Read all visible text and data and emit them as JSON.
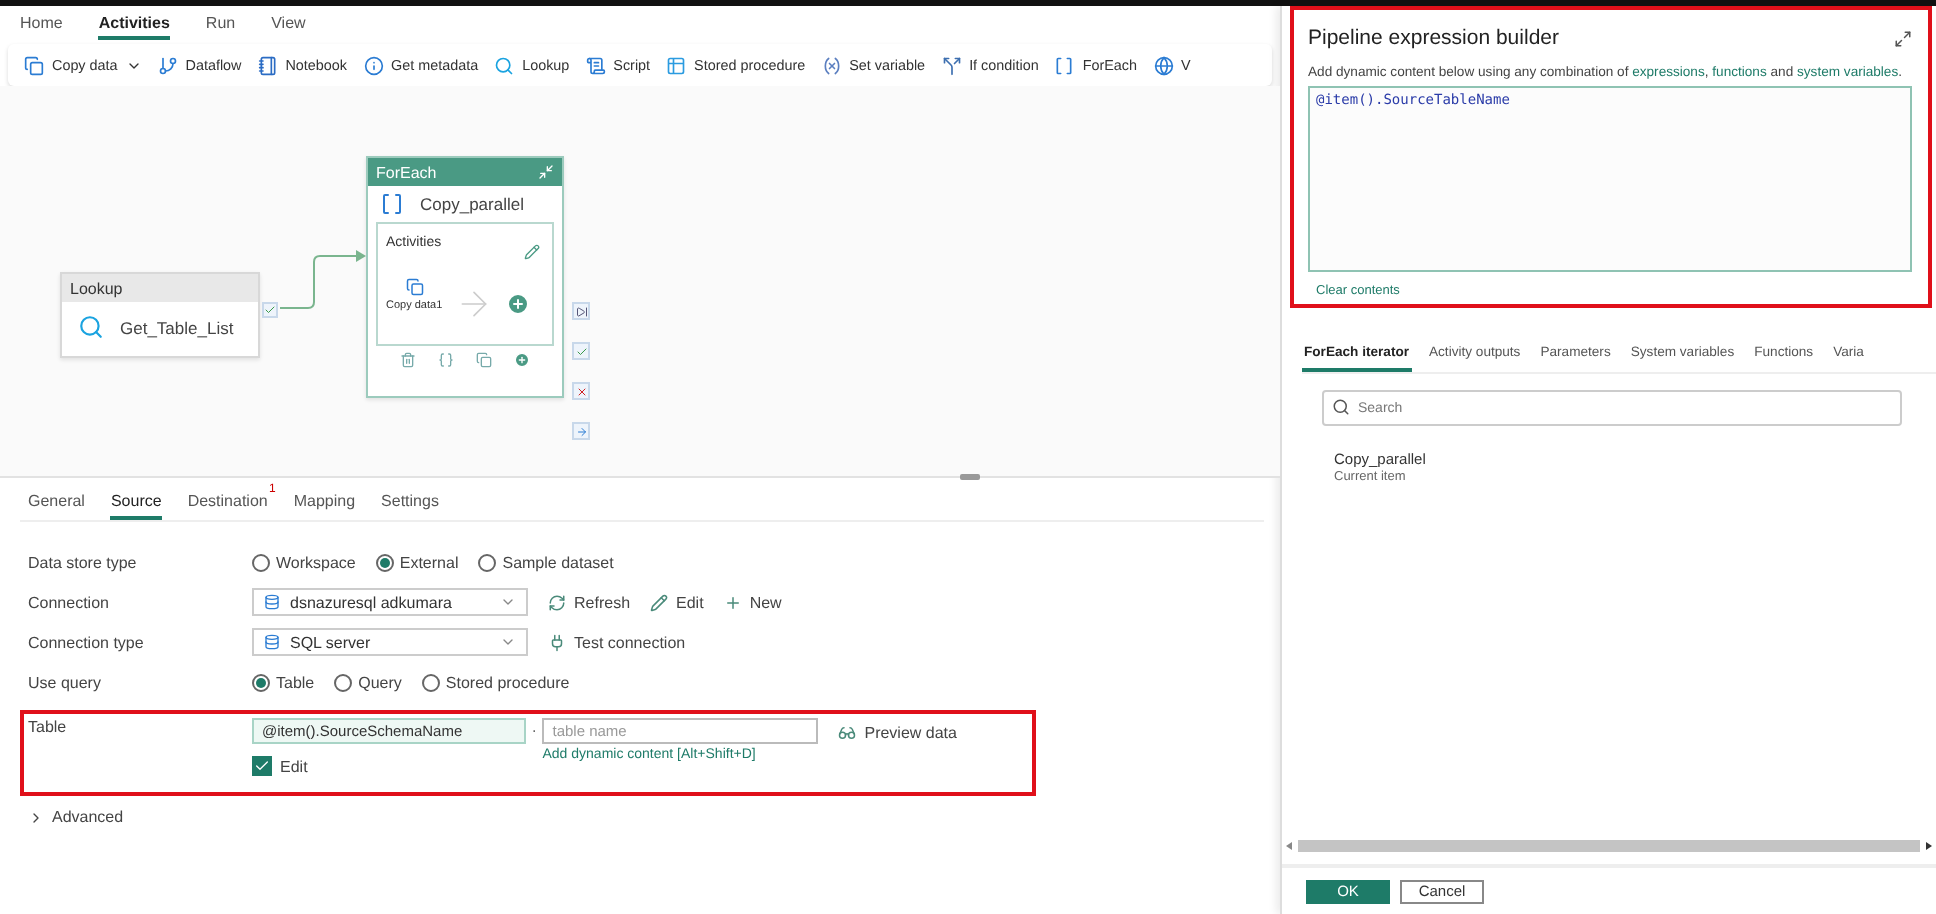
{
  "menu_tabs": [
    {
      "label": "Home",
      "selected": false
    },
    {
      "label": "Activities",
      "selected": true
    },
    {
      "label": "Run",
      "selected": false
    },
    {
      "label": "View",
      "selected": false
    }
  ],
  "toolbar": [
    {
      "label": "Copy data",
      "dropdown": true
    },
    {
      "label": "Dataflow",
      "dropdown": false
    },
    {
      "label": "Notebook",
      "dropdown": false
    },
    {
      "label": "Get metadata",
      "dropdown": false
    },
    {
      "label": "Lookup",
      "dropdown": false
    },
    {
      "label": "Script",
      "dropdown": false
    },
    {
      "label": "Stored procedure",
      "dropdown": false
    },
    {
      "label": "Set variable",
      "dropdown": false
    },
    {
      "label": "If condition",
      "dropdown": false
    },
    {
      "label": "ForEach",
      "dropdown": false
    },
    {
      "label": "V",
      "dropdown": false
    }
  ],
  "canvas": {
    "lookup": {
      "header": "Lookup",
      "name": "Get_Table_List"
    },
    "foreach": {
      "header": "ForEach",
      "name": "Copy_parallel",
      "activities_label": "Activities",
      "inner_activity": "Copy data1"
    }
  },
  "properties": {
    "tabs": [
      {
        "label": "General",
        "selected": false
      },
      {
        "label": "Source",
        "selected": true
      },
      {
        "label": "Destination",
        "selected": false,
        "badge": "1"
      },
      {
        "label": "Mapping",
        "selected": false
      },
      {
        "label": "Settings",
        "selected": false
      }
    ],
    "data_store_type": {
      "label": "Data store type",
      "options": [
        {
          "label": "Workspace",
          "selected": false
        },
        {
          "label": "External",
          "selected": true
        },
        {
          "label": "Sample dataset",
          "selected": false
        }
      ]
    },
    "connection": {
      "label": "Connection",
      "value": "dsnazuresql adkumara",
      "actions": [
        "Refresh",
        "Edit",
        "New"
      ]
    },
    "connection_type": {
      "label": "Connection type",
      "value": "SQL server",
      "action": "Test connection"
    },
    "use_query": {
      "label": "Use query",
      "options": [
        {
          "label": "Table",
          "selected": true
        },
        {
          "label": "Query",
          "selected": false
        },
        {
          "label": "Stored procedure",
          "selected": false
        }
      ]
    },
    "table": {
      "label": "Table",
      "schema_value": "@item().SourceSchemaName",
      "separator": ".",
      "table_placeholder": "table name",
      "preview": "Preview data",
      "dynamic_link": "Add dynamic content [Alt+Shift+D]",
      "edit": {
        "label": "Edit",
        "checked": true
      }
    },
    "advanced": {
      "label": "Advanced",
      "expanded": false
    }
  },
  "expression_builder": {
    "title": "Pipeline expression builder",
    "description": [
      {
        "kind": "text",
        "text": "Add dynamic content below using any combination of "
      },
      {
        "kind": "link",
        "text": "expressions"
      },
      {
        "kind": "text",
        "text": ", "
      },
      {
        "kind": "link",
        "text": "functions"
      },
      {
        "kind": "text",
        "text": " and "
      },
      {
        "kind": "link",
        "text": "system variables"
      },
      {
        "kind": "text",
        "text": "."
      }
    ],
    "expression": "@item().SourceTableName",
    "clear_link": "Clear contents",
    "tabs": [
      {
        "label": "ForEach iterator",
        "selected": true
      },
      {
        "label": "Activity outputs",
        "selected": false
      },
      {
        "label": "Parameters",
        "selected": false
      },
      {
        "label": "System variables",
        "selected": false
      },
      {
        "label": "Functions",
        "selected": false
      },
      {
        "label": "Varia",
        "selected": false
      }
    ],
    "search": {
      "placeholder": "Search"
    },
    "items": [
      {
        "name": "Copy_parallel",
        "subtitle": "Current item"
      }
    ],
    "buttons": [
      {
        "label": "OK",
        "kind": "primary"
      },
      {
        "label": "Cancel",
        "kind": "secondary"
      }
    ]
  }
}
